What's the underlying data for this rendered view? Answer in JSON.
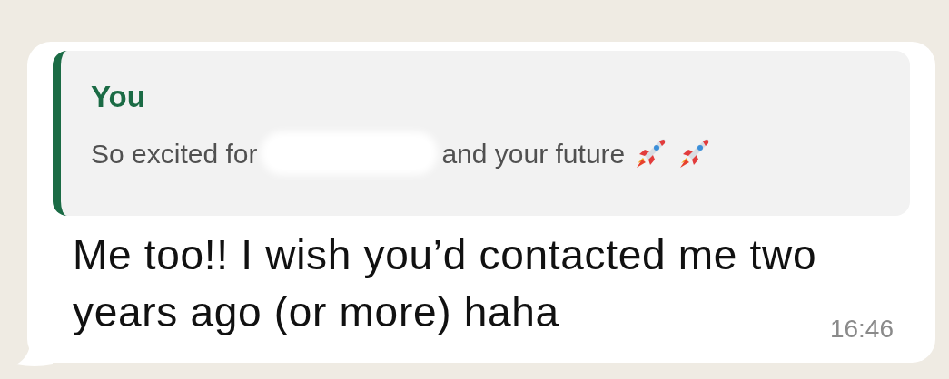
{
  "message": {
    "quote": {
      "author": "You",
      "text_before": "So excited for",
      "text_after": "and your future",
      "redacted": true
    },
    "text": "Me too!! I wish you’d contacted me two years ago (or more) haha",
    "time": "16:46"
  }
}
